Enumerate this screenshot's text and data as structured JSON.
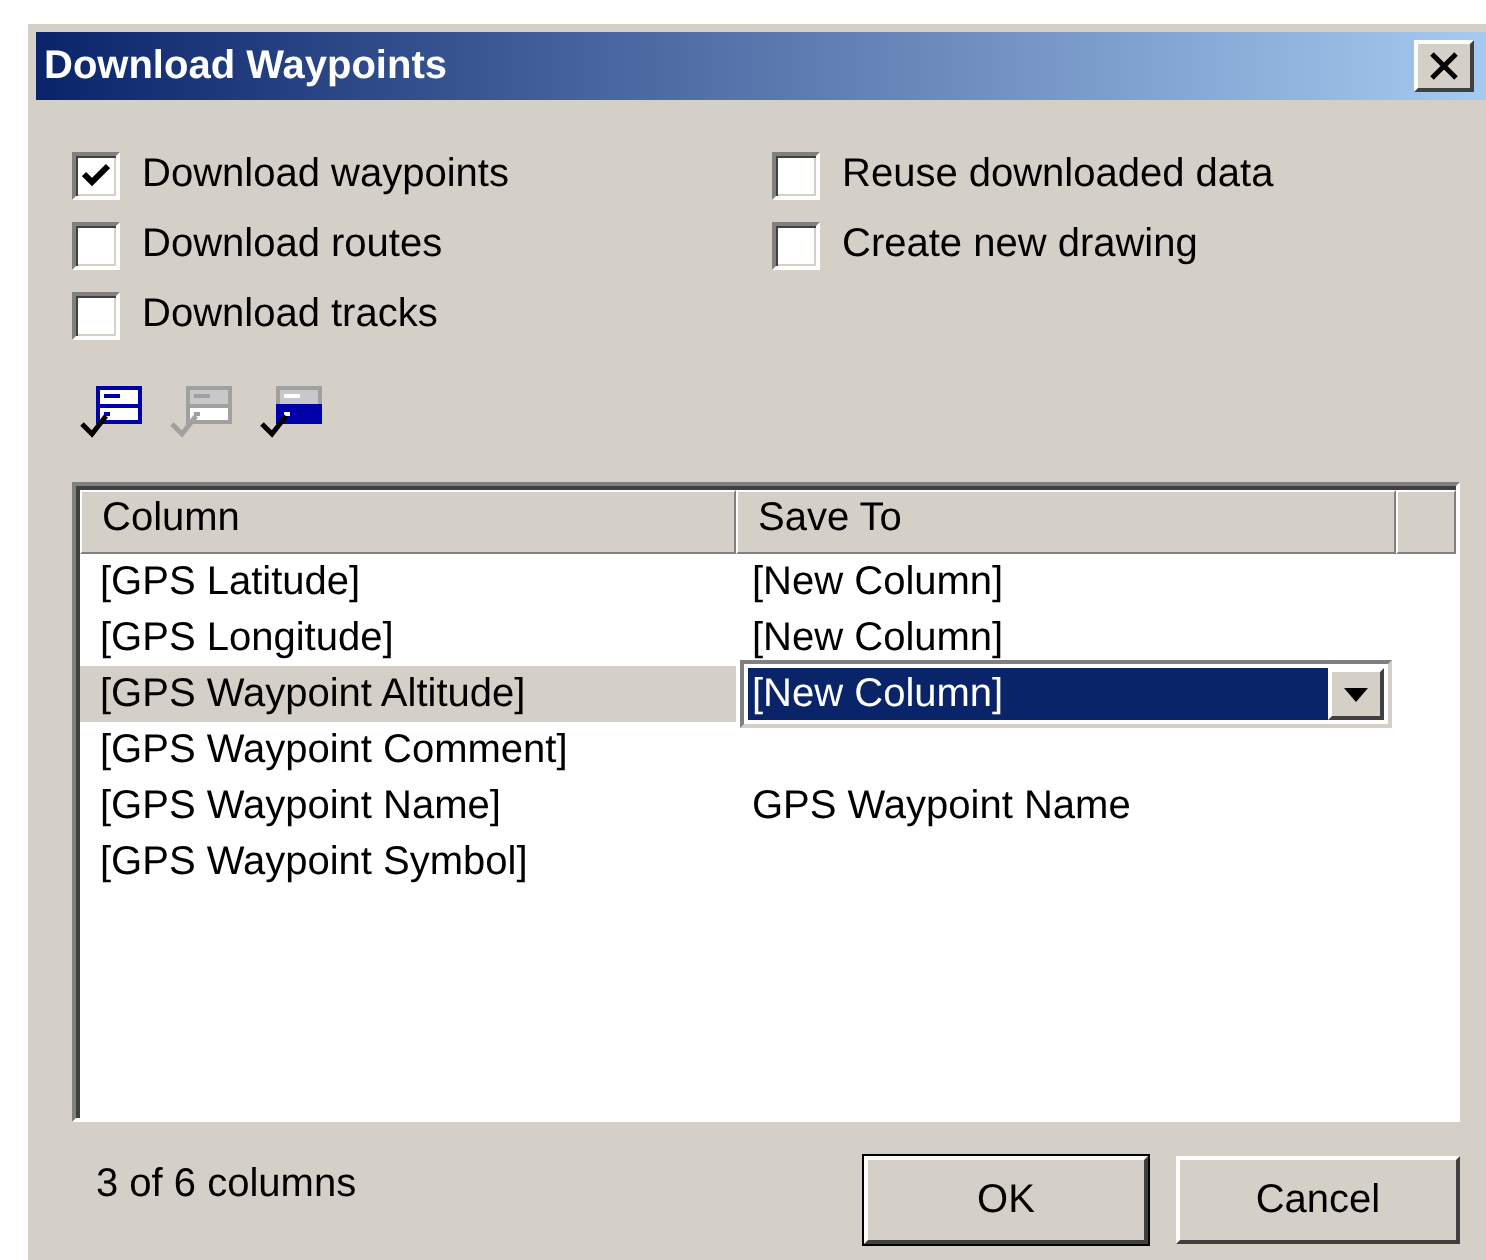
{
  "window": {
    "title": "Download Waypoints"
  },
  "options": [
    {
      "label": "Download waypoints",
      "checked": true
    },
    {
      "label": "Download routes",
      "checked": false
    },
    {
      "label": "Download tracks",
      "checked": false
    },
    {
      "label": "Reuse downloaded data",
      "checked": false
    },
    {
      "label": "Create new drawing",
      "checked": false
    }
  ],
  "toolbar": [
    {
      "disabled": false
    },
    {
      "disabled": true
    },
    {
      "disabled": false
    }
  ],
  "table": {
    "columns": [
      "Column",
      "Save To"
    ],
    "rows": [
      {
        "column": "[GPS Latitude]",
        "save_to": "[New Column]",
        "selected": false
      },
      {
        "column": "[GPS Longitude]",
        "save_to": "[New Column]",
        "selected": false
      },
      {
        "column": "[GPS Waypoint Altitude]",
        "save_to": "[New Column]",
        "selected": true
      },
      {
        "column": "[GPS Waypoint Comment]",
        "selected": false
      },
      {
        "column": "[GPS Waypoint Name]",
        "save_to": "GPS Waypoint Name",
        "selected": false
      },
      {
        "column": "[GPS Waypoint Symbol]",
        "selected": false
      }
    ]
  },
  "status": "3 of 6 columns",
  "buttons": [
    {
      "label": "OK",
      "default": true
    },
    {
      "label": "Cancel",
      "default": false
    }
  ]
}
